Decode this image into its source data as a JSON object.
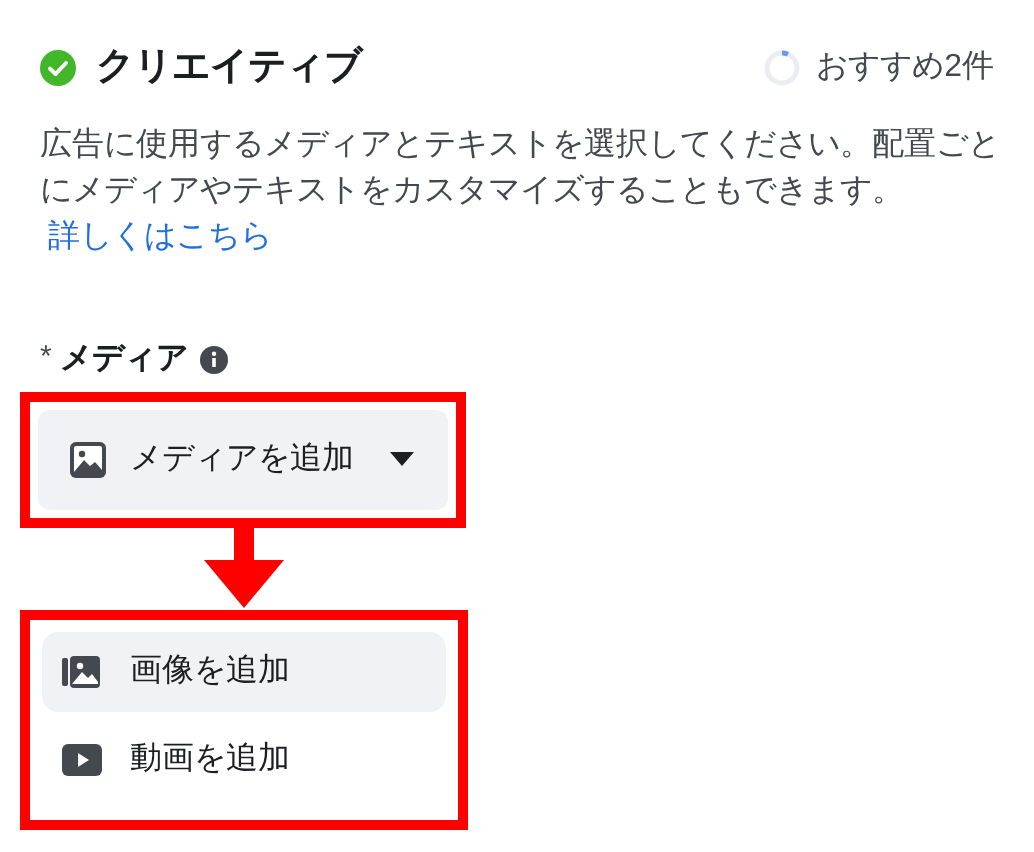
{
  "section": {
    "title": "クリエイティブ",
    "complete": true,
    "recommendations": "おすすめ2件"
  },
  "description": {
    "text": "広告に使用するメディアとテキストを選択してください。配置ごとにメディアやテキストをカスタマイズすることもできます。",
    "link": "詳しくはこちら"
  },
  "media": {
    "required_mark": "*",
    "label": "メディア",
    "button": "メディアを追加"
  },
  "menu": [
    {
      "kind": "image",
      "label": "画像を追加",
      "selected": true
    },
    {
      "kind": "video",
      "label": "動画を追加",
      "selected": false
    }
  ]
}
